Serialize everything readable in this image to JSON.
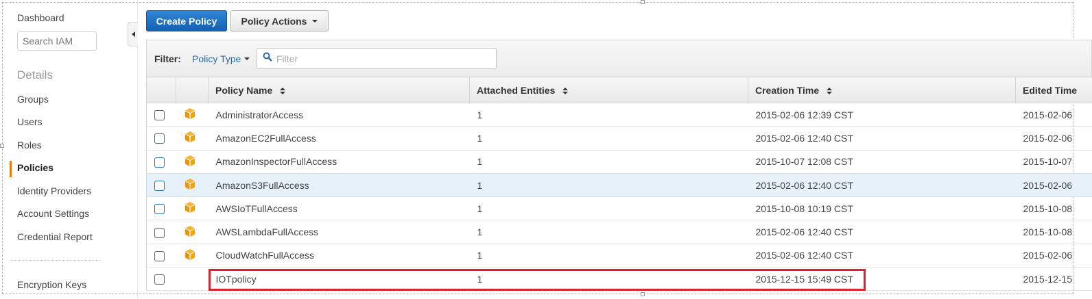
{
  "sidebar": {
    "dashboard": "Dashboard",
    "search_placeholder": "Search IAM",
    "section_title": "Details",
    "items": [
      {
        "label": "Groups"
      },
      {
        "label": "Users"
      },
      {
        "label": "Roles"
      },
      {
        "label": "Policies",
        "active": true
      },
      {
        "label": "Identity Providers"
      },
      {
        "label": "Account Settings"
      },
      {
        "label": "Credential Report"
      }
    ],
    "encryption_keys": "Encryption Keys"
  },
  "toolbar": {
    "create_policy": "Create Policy",
    "policy_actions": "Policy Actions"
  },
  "filter": {
    "label": "Filter:",
    "type_label": "Policy Type",
    "placeholder": "Filter"
  },
  "table": {
    "columns": [
      "Policy Name",
      "Attached Entities",
      "Creation Time",
      "Edited Time"
    ],
    "rows": [
      {
        "name": "AdministratorAccess",
        "attached": "1",
        "created": "2015-02-06 12:39 CST",
        "edited": "2015-02-06",
        "aws_managed": true
      },
      {
        "name": "AmazonEC2FullAccess",
        "attached": "1",
        "created": "2015-02-06 12:40 CST",
        "edited": "2015-02-06",
        "aws_managed": true
      },
      {
        "name": "AmazonInspectorFullAccess",
        "attached": "1",
        "created": "2015-10-07 12:08 CST",
        "edited": "2015-10-07",
        "aws_managed": true
      },
      {
        "name": "AmazonS3FullAccess",
        "attached": "1",
        "created": "2015-02-06 12:40 CST",
        "edited": "2015-02-06",
        "aws_managed": true,
        "hover": true
      },
      {
        "name": "AWSIoTFullAccess",
        "attached": "1",
        "created": "2015-10-08 10:19 CST",
        "edited": "2015-10-08",
        "aws_managed": true
      },
      {
        "name": "AWSLambdaFullAccess",
        "attached": "1",
        "created": "2015-02-06 12:40 CST",
        "edited": "2015-10-08",
        "aws_managed": true
      },
      {
        "name": "CloudWatchFullAccess",
        "attached": "1",
        "created": "2015-02-06 12:40 CST",
        "edited": "2015-02-06",
        "aws_managed": true
      },
      {
        "name": "IOTpolicy",
        "attached": "1",
        "created": "2015-12-15 15:49 CST",
        "edited": "2015-12-15",
        "aws_managed": false
      }
    ]
  },
  "colors": {
    "primary_button": "#1a6fc4",
    "active_marker": "#e47911",
    "aws_icon": "#f0a30a",
    "annotation": "#d8242a",
    "row_highlight": "#e6f1fa"
  },
  "icons": {
    "aws_managed": "cube-icon",
    "filter_search": "search-icon"
  }
}
